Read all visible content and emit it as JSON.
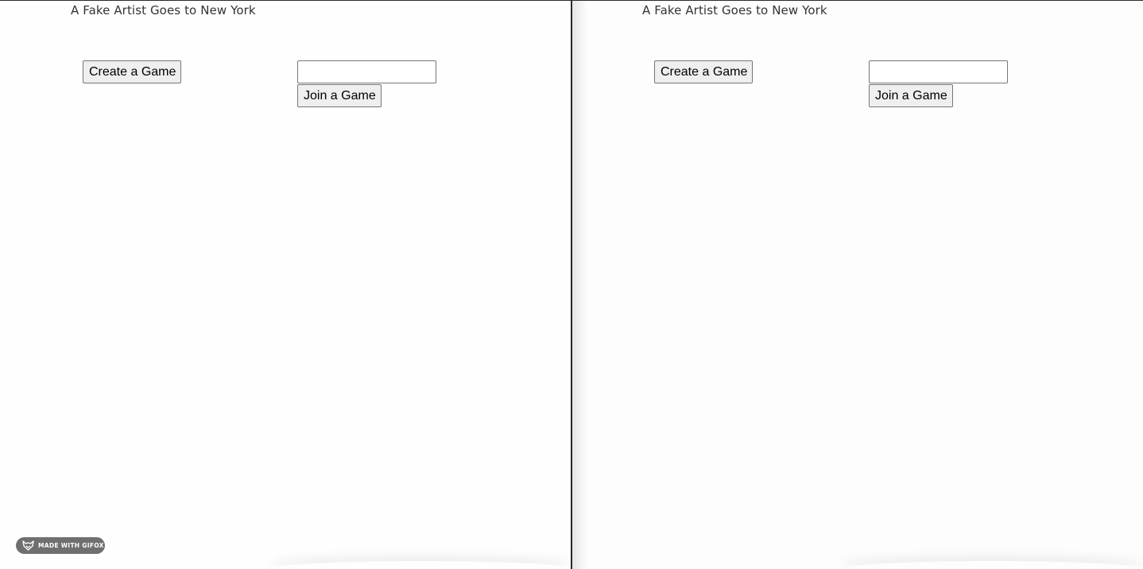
{
  "panes": {
    "left": {
      "title": "A Fake Artist Goes to New York",
      "create_button": "Create a Game",
      "game_code_input": {
        "value": "",
        "placeholder": ""
      },
      "join_button": "Join a Game"
    },
    "right": {
      "title": "A Fake Artist Goes to New York",
      "create_button": "Create a Game",
      "game_code_input": {
        "value": "",
        "placeholder": ""
      },
      "join_button": "Join a Game"
    }
  },
  "watermark": {
    "text": "MADE WITH GIFOX",
    "icon": "fox-icon",
    "color": "#6f6f6f"
  }
}
